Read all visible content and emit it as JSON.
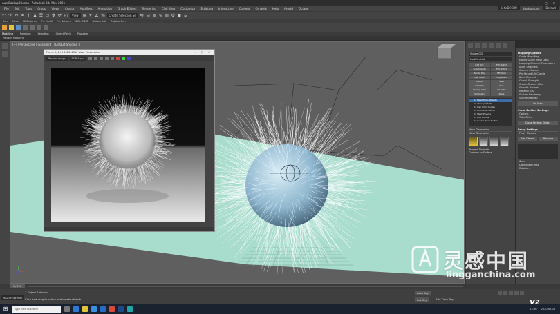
{
  "window": {
    "title": "AutoBackup03.max - Autodesk 3ds Max 2021",
    "controls": [
      "–",
      "□",
      "✕"
    ]
  },
  "menubar": {
    "items": [
      "File",
      "Edit",
      "Tools",
      "Group",
      "Views",
      "Create",
      "Modifiers",
      "Animation",
      "Graph Editors",
      "Rendering",
      "Civil View",
      "Customize",
      "Scripting",
      "Interactive",
      "Content",
      "Ornatrix",
      "Help",
      "Arnold",
      "Octane"
    ],
    "user": "KeKeDCCHU",
    "workspace_label": "Workspaces:",
    "workspace_value": "Default"
  },
  "toolbar": {
    "view_combo": "View",
    "selection_set": "Create Selection Se"
  },
  "ribbon": {
    "labels": [
      "Ears",
      "Mesh",
      "FX Distance",
      "Pri: Kinfill",
      "Pri: Bottom",
      "0BD - 0.2/2",
      "Ribbon Unit",
      "Outside Gen"
    ],
    "tabs": [
      "Modeling",
      "Freeform",
      "Selection",
      "Object Paint",
      "Populate"
    ],
    "active_tab": "Modeling",
    "sub_label": "Polygon Modeling"
  },
  "viewport": {
    "label": "[+] [Perspective ] [Standard ] [Default Shading ]"
  },
  "frame_window": {
    "title": "Frame 0, 1 / 1  1920x1080  View: Perspective",
    "area_label": "Render Image",
    "channel": "RGB Alpha"
  },
  "command_panel": {
    "object_name": "Sphere001",
    "modifier_list": "Modifier List",
    "modifier_buttons": [
      "Edit Poly",
      "FFD 2x2x2",
      "TurboSmooth",
      "FFD 3x3x3",
      "Turn to Poly",
      "FFD(box)",
      "Cap Holes",
      "PolySelect",
      "Smooth",
      "Shell",
      "UVW Map",
      "Skin",
      "Unwrap UVW",
      "Chamfer",
      "Symmetry",
      "Noise"
    ],
    "stack": [
      "Ox Mesh From Strands",
      "Ox Change Width",
      "Ox Hair From Guides",
      "Ox Animation Cache",
      "Ox Mesh Physics",
      "Ox Edit Guides",
      "Ox Guides From Surface"
    ],
    "selected_stack_index": 0,
    "mesh_generation_header": "Mesh Generation",
    "mesh_generation_label": "Mesh Generation",
    "tangent_label": "Tangent Normals",
    "conform_label": "Conform to Surface"
  },
  "mapping_panel": {
    "header": "Mapping Options",
    "guide_mesh_map": "Guide Mesh Map",
    "export_label": "Export Guide Mesh Data",
    "channel_header": "Mapping Channel Parameters",
    "num_channels": "Num. Channels",
    "current_channel": "Current Channel",
    "per_strand": "Per-Strand UV Coords",
    "base_channel": "Base Channel",
    "guard_strength": "Guard. Strength",
    "create_texture": "Create Texture Atlas",
    "smooth_normals": "Smooth Normals",
    "material_id": "Material IDs",
    "scatter_randomly": "Scatter Randomly",
    "scattering_map": "Scattering Map",
    "no_map": "No Map",
    "cross_header": "Cross Section Settings",
    "options": "Options",
    "tube_sides": "Tube Sides",
    "cross_section_object": "Cross Section Object",
    "proxy_header": "Proxy Settings",
    "proxy_meshes": "Proxy Meshes",
    "add_object": "Add Object",
    "remove": "Remove",
    "seed": "Seed",
    "distribution_map": "Distribution Map",
    "rotation": "Rotation"
  },
  "timeline": {
    "frame_display": "0 / 100"
  },
  "statusbar": {
    "maxscript": "MAXScript Mini",
    "selected": "1 Object Selected",
    "hint": "Click and drag to select and create objects",
    "auto_key": "Auto Key",
    "set_key": "Set Key",
    "add_time_tag": "Add Time Tag",
    "selected_combo": "Selected"
  },
  "taskbar": {
    "search": "Type here to search",
    "time": "11:56",
    "date": "2020-05-06"
  },
  "watermark": {
    "chinese": "灵感中国",
    "url": "lingganchina.com"
  },
  "corner_logo": "V2",
  "colors": {
    "floor": "#a8dccd",
    "fur_tips": "#ffffff",
    "sphere": "#8fb7cf",
    "selected_stack": "#3b6ea8"
  }
}
